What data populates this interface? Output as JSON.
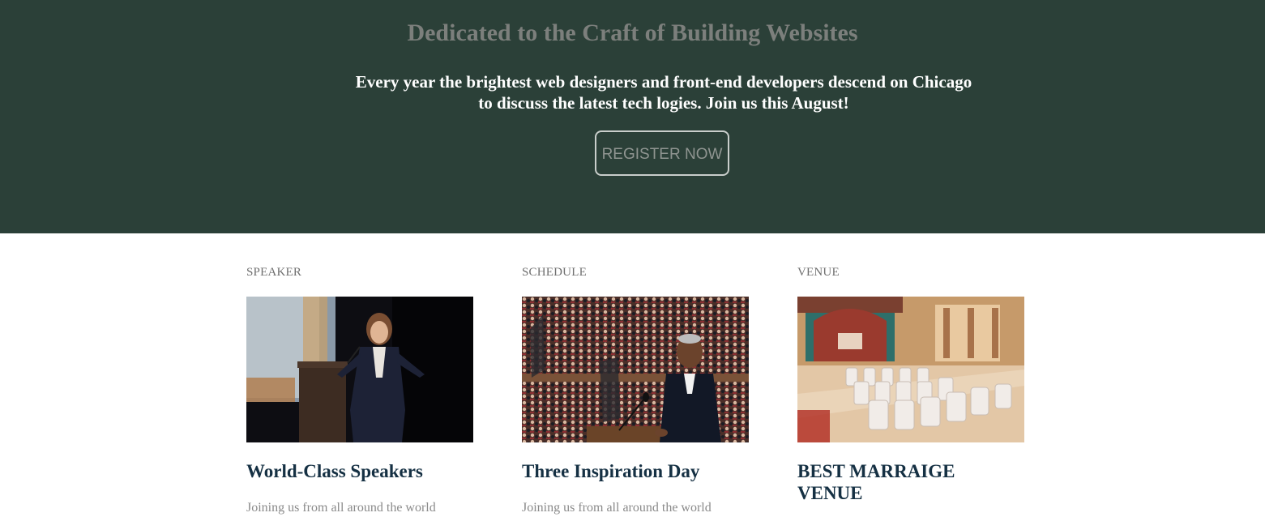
{
  "hero": {
    "title": "Dedicated to the Craft of Building Websites",
    "subtitle": "Every year the brightest web designers and front-end developers descend on Chicago to discuss the latest tech logies. Join us this August!",
    "register_label": "REGISTER NOW"
  },
  "cards": [
    {
      "category": "SPEAKER",
      "title": "World-Class Speakers",
      "text": "Joining us from all around the world",
      "image": "speaker-photo"
    },
    {
      "category": "SCHEDULE",
      "title": "Three Inspiration Day",
      "text": "Joining us from all around the world",
      "image": "schedule-photo"
    },
    {
      "category": "VENUE",
      "title": "BEST MARRAIGE VENUE",
      "text": "",
      "image": "venue-photo"
    }
  ],
  "colors": {
    "hero_bg": "#2b4038",
    "title_gray": "#7c7f7c",
    "card_title": "#153043"
  }
}
